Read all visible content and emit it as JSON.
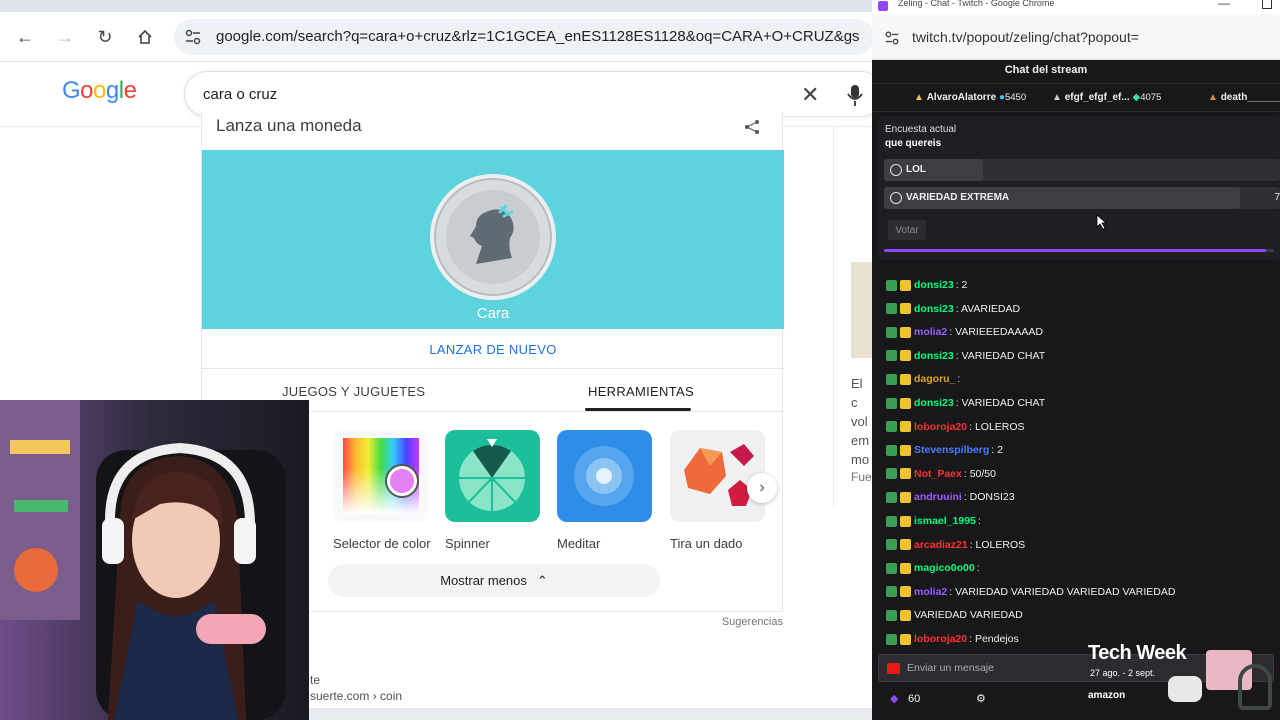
{
  "google_window": {
    "address": "google.com/search?q=cara+o+cruz&rlz=1C1GCEA_enES1128ES1128&oq=CARA+O+CRUZ&gs",
    "logo": "Google",
    "search_query": "cara o cruz",
    "coin_widget": {
      "title": "Lanza una moneda",
      "result": "Cara",
      "relaunch": "LANZAR DE NUEVO",
      "tabs": [
        "JUEGOS Y JUGUETES",
        "HERRAMIENTAS"
      ],
      "active_tab": "HERRAMIENTAS",
      "tools": [
        {
          "label": "Selector de color",
          "icon": "color-picker-icon"
        },
        {
          "label": "Spinner",
          "icon": "spinner-icon"
        },
        {
          "label": "Meditar",
          "icon": "meditate-icon"
        },
        {
          "label": "Tira un dado",
          "icon": "dice-icon"
        }
      ],
      "show_less": "Mostrar menos",
      "suggestions": "Sugerencias"
    },
    "right_snippet": "El c vol em mo",
    "right_source": "Fue",
    "bottom_snippet_title": "te",
    "bottom_snippet_url": "suerte.com › coin"
  },
  "twitch_window": {
    "window_title": "Zeling - Chat - Twitch - Google Chrome",
    "address": "twitch.tv/popout/zeling/chat?popout=",
    "header_title": "Chat del stream",
    "leaderboard": [
      {
        "name": "AlvaroAlatorre",
        "amount": "5450"
      },
      {
        "name": "efgf_efgf_ef...",
        "amount": "4075"
      },
      {
        "name": "death_______..."
      }
    ],
    "poll": {
      "label": "Encuesta actual",
      "question": "que quereis",
      "options": [
        {
          "label": "LOL",
          "fraction": 0.25
        },
        {
          "label": "VARIEDAD EXTREMA",
          "fraction": 0.9,
          "pct": "7"
        }
      ],
      "vote_label": "Votar",
      "time_fraction": 0.98
    },
    "messages": [
      {
        "user": "donsi23",
        "text": ": 2",
        "color": "#00ff7f"
      },
      {
        "user": "donsi23",
        "text": ": AVARIEDAD",
        "color": "#00ff7f"
      },
      {
        "user": "molia2",
        "text": ": VARIEEEDAAAAD",
        "color": "#9a5cff"
      },
      {
        "user": "donsi23",
        "text": ": VARIEDAD CHAT",
        "color": "#00ff7f"
      },
      {
        "user": "dagoru_",
        "text": ":",
        "color": "#daa520"
      },
      {
        "user": "donsi23",
        "text": ": VARIEDAD CHAT",
        "color": "#00ff7f"
      },
      {
        "user": "loboroja20",
        "text": ": LOLEROS",
        "color": "#ff3030"
      },
      {
        "user": "Stevenspilberg",
        "text": ": 2",
        "color": "#4c7bff"
      },
      {
        "user": "Not_Paex",
        "text": ": 50/50",
        "color": "#ff3030"
      },
      {
        "user": "andruuini",
        "text": ": DONSI23",
        "color": "#9a5cff"
      },
      {
        "user": "ismael_1995",
        "text": ":",
        "color": "#00ff7f"
      },
      {
        "user": "arcadiaz21",
        "text": ": LOLEROS",
        "color": "#ff3030"
      },
      {
        "user": "magico0o00",
        "text": ":",
        "color": "#00ff7f"
      },
      {
        "user": "molia2",
        "text": ": VARIEDAD VARIEDAD VARIEDAD VARIEDAD",
        "color": "#9a5cff"
      },
      {
        "user": "",
        "text": "VARIEDAD VARIEDAD",
        "color": "#efeff1"
      },
      {
        "user": "loboroja20",
        "text": ": Pendejos",
        "color": "#ff3030"
      }
    ],
    "input_placeholder": "Enviar un mensaje",
    "points": "60",
    "overlay": {
      "title": "Tech Week",
      "dates": "27 ago. - 2 sept.",
      "sponsor": "amazon"
    }
  }
}
